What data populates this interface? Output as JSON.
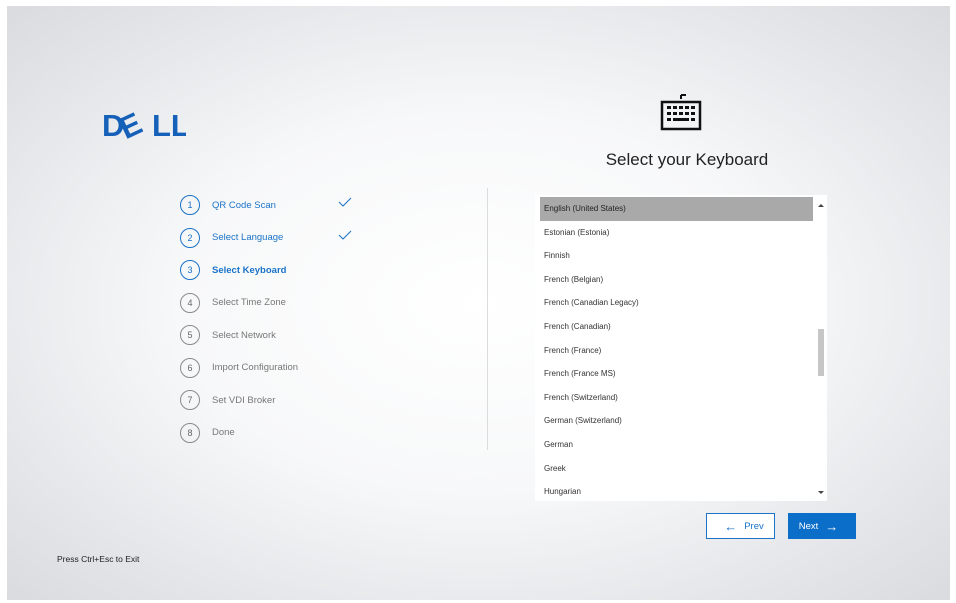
{
  "brand": {
    "logo_text": "DELL"
  },
  "header": {
    "title": "Select your Keyboard",
    "icon": "keyboard-icon"
  },
  "steps": [
    {
      "num": "1",
      "label": "QR Code Scan",
      "state": "done"
    },
    {
      "num": "2",
      "label": "Select Language",
      "state": "done"
    },
    {
      "num": "3",
      "label": "Select Keyboard",
      "state": "active"
    },
    {
      "num": "4",
      "label": "Select Time Zone",
      "state": "pending"
    },
    {
      "num": "5",
      "label": "Select Network",
      "state": "pending"
    },
    {
      "num": "6",
      "label": "Import Configuration",
      "state": "pending"
    },
    {
      "num": "7",
      "label": "Set VDI Broker",
      "state": "pending"
    },
    {
      "num": "8",
      "label": "Done",
      "state": "pending"
    }
  ],
  "keyboard_list": {
    "items": [
      "English (United States)",
      "Estonian (Estonia)",
      "Finnish",
      "French (Belgian)",
      "French (Canadian Legacy)",
      "French (Canadian)",
      "French (France)",
      "French (France MS)",
      "French (Switzerland)",
      "German (Switzerland)",
      "German",
      "Greek",
      "Hungarian"
    ],
    "selected": "English (United States)"
  },
  "nav": {
    "prev_label": "Prev",
    "next_label": "Next"
  },
  "footer": {
    "exit_hint": "Press Ctrl+Esc to Exit"
  },
  "colors": {
    "accent": "#1a73c8",
    "next_bg": "#0b6fc9",
    "selected_row": "#a9a9a9"
  }
}
